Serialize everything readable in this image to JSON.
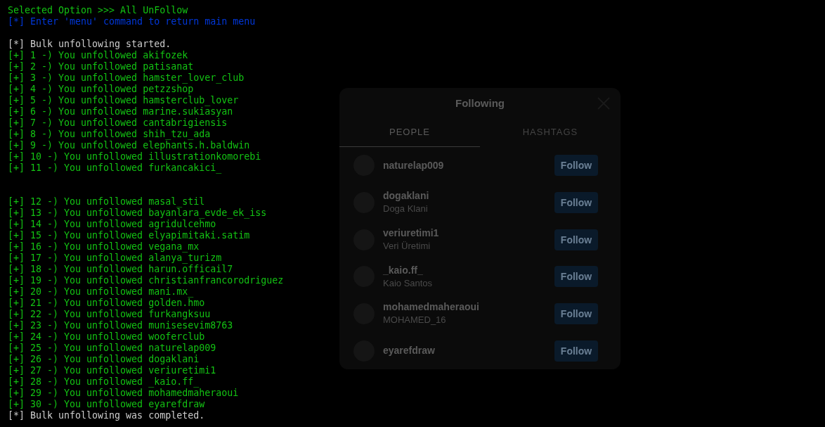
{
  "terminal": {
    "lines": [
      {
        "kind": "title",
        "text": "Selected Option >>> All UnFollow"
      },
      {
        "kind": "info",
        "text": "[*] Enter 'menu' command to return main menu"
      },
      {
        "kind": "blank"
      },
      {
        "kind": "status",
        "text": "[*] Bulk unfollowing started."
      },
      {
        "kind": "result",
        "text": "[+] 1 -) You unfollowed akifozek"
      },
      {
        "kind": "result",
        "text": "[+] 2 -) You unfollowed patisanat"
      },
      {
        "kind": "result",
        "text": "[+] 3 -) You unfollowed hamster_lover_club"
      },
      {
        "kind": "result",
        "text": "[+] 4 -) You unfollowed petzzshop"
      },
      {
        "kind": "result",
        "text": "[+] 5 -) You unfollowed hamsterclub_lover"
      },
      {
        "kind": "result",
        "text": "[+] 6 -) You unfollowed marine.sukiasyan"
      },
      {
        "kind": "result",
        "text": "[+] 7 -) You unfollowed cantabrigiensis"
      },
      {
        "kind": "result",
        "text": "[+] 8 -) You unfollowed shih_tzu_ada"
      },
      {
        "kind": "result",
        "text": "[+] 9 -) You unfollowed elephants.h.baldwin"
      },
      {
        "kind": "result",
        "text": "[+] 10 -) You unfollowed illustrationkomorebi"
      },
      {
        "kind": "result",
        "text": "[+] 11 -) You unfollowed furkancakici_"
      },
      {
        "kind": "blank"
      },
      {
        "kind": "blank"
      },
      {
        "kind": "result",
        "text": "[+] 12 -) You unfollowed masal_stil"
      },
      {
        "kind": "result",
        "text": "[+] 13 -) You unfollowed bayanlara_evde_ek_iss"
      },
      {
        "kind": "result",
        "text": "[+] 14 -) You unfollowed agridulcehmo"
      },
      {
        "kind": "result",
        "text": "[+] 15 -) You unfollowed elyapimitaki.satim"
      },
      {
        "kind": "result",
        "text": "[+] 16 -) You unfollowed vegana_mx"
      },
      {
        "kind": "result",
        "text": "[+] 17 -) You unfollowed alanya_turizm"
      },
      {
        "kind": "result",
        "text": "[+] 18 -) You unfollowed harun.officail7"
      },
      {
        "kind": "result",
        "text": "[+] 19 -) You unfollowed christianfrancorodriguez"
      },
      {
        "kind": "result",
        "text": "[+] 20 -) You unfollowed mani.mx_"
      },
      {
        "kind": "result",
        "text": "[+] 21 -) You unfollowed golden.hmo"
      },
      {
        "kind": "result",
        "text": "[+] 22 -) You unfollowed furkangksuu"
      },
      {
        "kind": "result",
        "text": "[+] 23 -) You unfollowed munisesevim8763"
      },
      {
        "kind": "result",
        "text": "[+] 24 -) You unfollowed wooferclub"
      },
      {
        "kind": "result",
        "text": "[+] 25 -) You unfollowed naturelap009"
      },
      {
        "kind": "result",
        "text": "[+] 26 -) You unfollowed dogaklani"
      },
      {
        "kind": "result",
        "text": "[+] 27 -) You unfollowed veriuretimi1"
      },
      {
        "kind": "result",
        "text": "[+] 28 -) You unfollowed _kaio.ff_"
      },
      {
        "kind": "result",
        "text": "[+] 29 -) You unfollowed mohamedmaheraoui"
      },
      {
        "kind": "result",
        "text": "[+] 30 -) You unfollowed eyarefdraw"
      },
      {
        "kind": "status",
        "text": "[*] Bulk unfollowing was completed."
      }
    ]
  },
  "background_dialog": {
    "title": "Following",
    "tabs": [
      {
        "label": "PEOPLE",
        "selected": true
      },
      {
        "label": "HASHTAGS",
        "selected": false
      }
    ],
    "accounts": [
      {
        "username": "naturelap009",
        "button": "Follow"
      },
      {
        "username": "dogaklani",
        "name": "Doga Klani",
        "button": "Follow"
      },
      {
        "username": "veriuretimi1",
        "name": "Veri Üretimi",
        "button": "Follow"
      },
      {
        "username": "_kaio.ff_",
        "name": "Kaio Santos",
        "button": "Follow"
      },
      {
        "username": "mohamedmaheraoui",
        "name": "MOHAMED_16",
        "button": "Follow"
      },
      {
        "username": "eyarefdraw",
        "button": "Follow"
      }
    ]
  }
}
